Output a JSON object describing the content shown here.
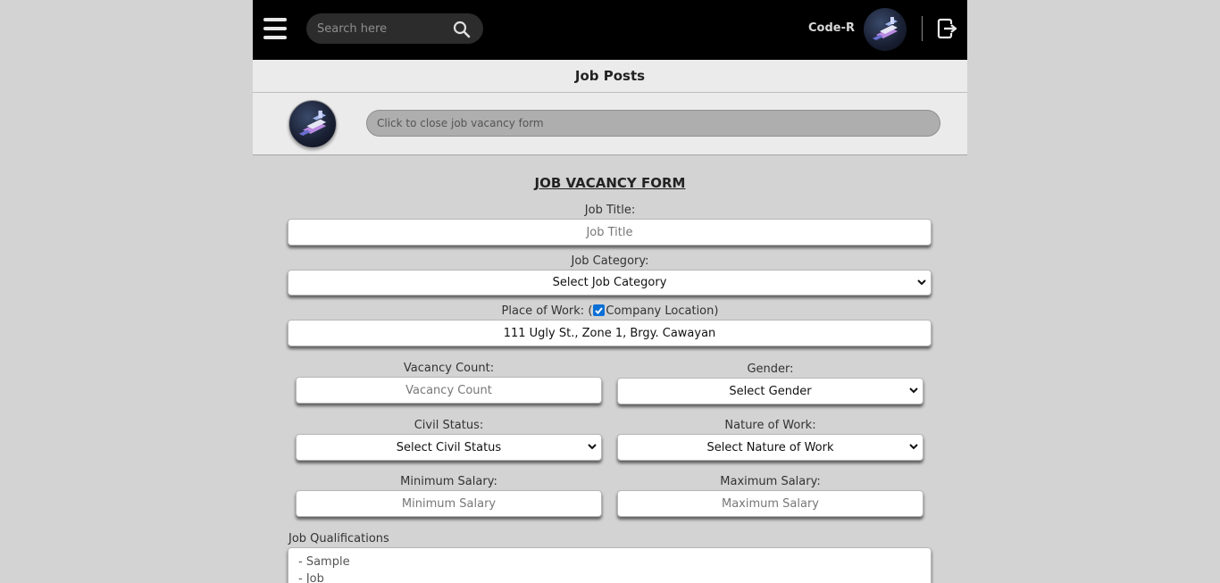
{
  "header": {
    "search_placeholder": "Search here",
    "username": "Code-R",
    "icons": [
      "hamburger-menu-icon",
      "search-icon",
      "avatar",
      "logout-icon"
    ]
  },
  "page": {
    "section_title": "Job Posts",
    "toggle_form_label": "Click to close job vacancy form"
  },
  "form": {
    "title": "JOB VACANCY FORM",
    "job_title_label": "Job Title:",
    "job_title_placeholder": "Job Title",
    "job_category_label": "Job Category:",
    "job_category_value": "Select Job Category",
    "place_of_work_label_prefix": "Place of Work: (",
    "company_location_label": "Company Location)",
    "company_location_checked": true,
    "place_of_work_value": "111 Ugly St., Zone 1, Brgy. Cawayan",
    "vacancy_count_label": "Vacancy Count:",
    "vacancy_count_placeholder": "Vacancy Count",
    "gender_label": "Gender:",
    "gender_value": "Select Gender",
    "civil_status_label": "Civil Status:",
    "civil_status_value": "Select Civil Status",
    "nature_of_work_label": "Nature of Work:",
    "nature_of_work_value": "Select Nature of Work",
    "min_salary_label": "Minimum Salary:",
    "min_salary_placeholder": "Minimum Salary",
    "max_salary_label": "Maximum Salary:",
    "max_salary_placeholder": "Maximum Salary",
    "qualifications_label": "Job Qualifications",
    "qualifications_lines": [
      "- Sample",
      "- Job"
    ]
  },
  "colors": {
    "header_bg": "#000000",
    "page_bg": "#d3d3d3",
    "checkbox_accent": "#0b6fd6"
  }
}
